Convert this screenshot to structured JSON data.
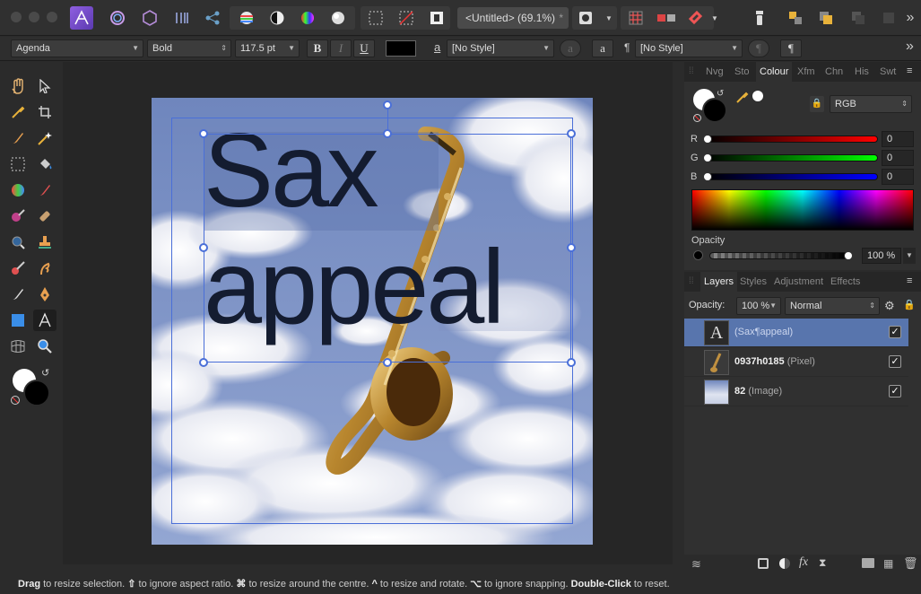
{
  "toolbar": {
    "document_title": "<Untitled> (69.1%)",
    "modified_marker": "*"
  },
  "context_bar": {
    "font_family": "Agenda",
    "font_style": "Bold",
    "font_size": "117.5 pt",
    "bold_label": "B",
    "italic_label": "I",
    "underline_label": "U",
    "text_color": "#000000",
    "char_style_glyph": "a",
    "char_style": "[No Style]",
    "para_style_glyph": "¶",
    "para_style": "[No Style]",
    "overflow_glyph": "»"
  },
  "canvas": {
    "text_line1": "Sax",
    "text_line2": "appeal",
    "sky_color": "#7f95c6",
    "selection_color": "#4a6fd8"
  },
  "colour_panel": {
    "tabs": [
      "Nvg",
      "Sto",
      "Colour",
      "Xfm",
      "Chn",
      "His",
      "Swt"
    ],
    "active_tab": "Colour",
    "model": "RGB",
    "r_label": "R",
    "r_value": "0",
    "g_label": "G",
    "g_value": "0",
    "b_label": "B",
    "b_value": "0",
    "opacity_label": "Opacity",
    "opacity_value": "100 %"
  },
  "layers_panel": {
    "tabs": [
      "Layers",
      "Styles",
      "Adjustment",
      "Effects"
    ],
    "active_tab": "Layers",
    "opacity_label": "Opacity:",
    "opacity_value": "100 %",
    "blend_mode": "Normal",
    "layers": [
      {
        "name": "(Sax¶appeal)",
        "type": "",
        "selected": true,
        "visible": true
      },
      {
        "name": "0937h0185",
        "type": "(Pixel)",
        "selected": false,
        "visible": true
      },
      {
        "name": "82",
        "type": "(Image)",
        "selected": false,
        "visible": true
      }
    ],
    "fx_label": "fx"
  },
  "status": {
    "s1": "Drag",
    "s2": " to resize selection. ",
    "s3": "⇧",
    "s4": " to ignore aspect ratio. ",
    "s5": "⌘",
    "s6": " to resize around the centre. ",
    "s7": "^",
    "s8": " to resize and rotate. ",
    "s9": "⌥",
    "s10": " to ignore snapping. ",
    "s11": "Double-Click",
    "s12": " to reset."
  }
}
